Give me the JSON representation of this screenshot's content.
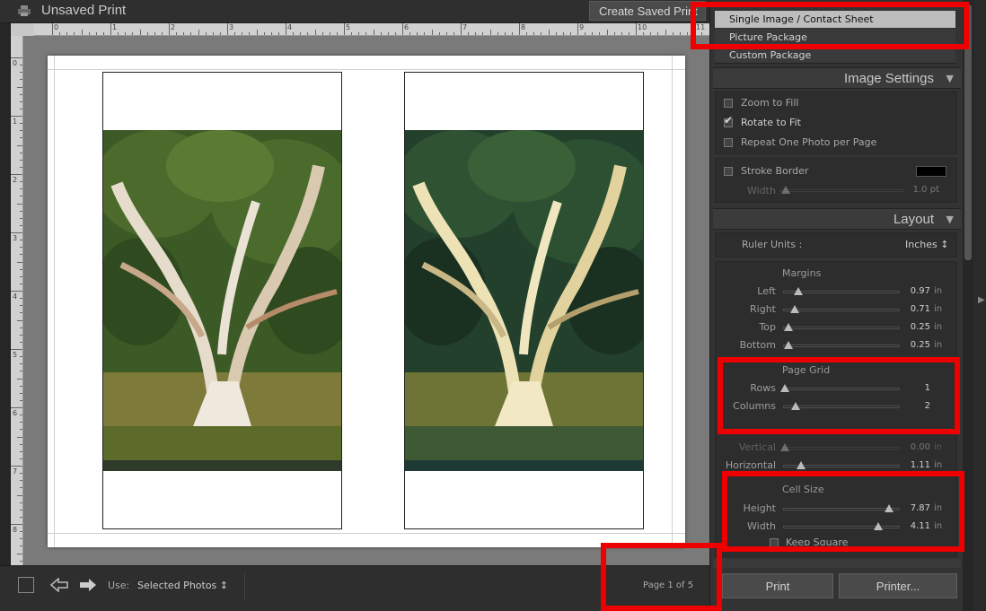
{
  "window": {
    "title": "Unsaved Print",
    "create_saved_label": "Create Saved Print"
  },
  "ruler": {
    "top_numbers": [
      "0",
      "1",
      "2",
      "3",
      "4",
      "5",
      "6",
      "7",
      "8",
      "9",
      "10",
      "11"
    ],
    "left_numbers": [
      "0",
      "1",
      "2",
      "3",
      "4",
      "5",
      "6",
      "7",
      "8"
    ]
  },
  "layout_style": {
    "items": [
      "Single Image / Contact Sheet",
      "Picture Package",
      "Custom Package"
    ],
    "selected": "Single Image / Contact Sheet"
  },
  "image_settings": {
    "title": "Image Settings",
    "zoom_to_fill": "Zoom to Fill",
    "rotate_to_fit": "Rotate to Fit",
    "repeat_one_photo": "Repeat One Photo per Page",
    "stroke_border": "Stroke Border",
    "stroke_width_label": "Width",
    "stroke_width_value": "1.0 pt",
    "stroke_width_fraction": 0.05,
    "stroke_color": "#000000",
    "checked": {
      "zoom_to_fill": false,
      "rotate_to_fit": true,
      "repeat_one_photo": false,
      "stroke_border": false
    }
  },
  "layout": {
    "title": "Layout",
    "ruler_units_label": "Ruler Units :",
    "ruler_units_value": "Inches ↕",
    "margins_title": "Margins",
    "margins": [
      {
        "label": "Left",
        "value": "0.97",
        "unit": "in",
        "fraction": 0.12
      },
      {
        "label": "Right",
        "value": "0.71",
        "unit": "in",
        "fraction": 0.09
      },
      {
        "label": "Top",
        "value": "0.25",
        "unit": "in",
        "fraction": 0.03
      },
      {
        "label": "Bottom",
        "value": "0.25",
        "unit": "in",
        "fraction": 0.03
      }
    ],
    "page_grid_title": "Page Grid",
    "page_grid": [
      {
        "label": "Rows",
        "value": "1",
        "unit": "",
        "fraction": 0.0
      },
      {
        "label": "Columns",
        "value": "2",
        "unit": "",
        "fraction": 0.1
      }
    ],
    "cell_spacing": [
      {
        "label": "Vertical",
        "value": "0.00",
        "unit": "in",
        "fraction": 0.0,
        "dim": true
      },
      {
        "label": "Horizontal",
        "value": "1.11",
        "unit": "in",
        "fraction": 0.15,
        "dim": false
      }
    ],
    "cell_size_title": "Cell Size",
    "cell_size": [
      {
        "label": "Height",
        "value": "7.87",
        "unit": "in",
        "fraction": 0.95
      },
      {
        "label": "Width",
        "value": "4.11",
        "unit": "in",
        "fraction": 0.85
      }
    ],
    "keep_square": "Keep Square"
  },
  "bottom_bar": {
    "use_label": "Use:",
    "use_value": "Selected Photos ↕",
    "page_indicator": "Page 1 of 5"
  },
  "buttons": {
    "print": "Print",
    "printer": "Printer..."
  },
  "colors": {
    "highlight": "#ee0000",
    "panel_bg": "#333333",
    "work_bg": "#7a7a7a",
    "selected_item_bg": "#bdbdbd"
  }
}
